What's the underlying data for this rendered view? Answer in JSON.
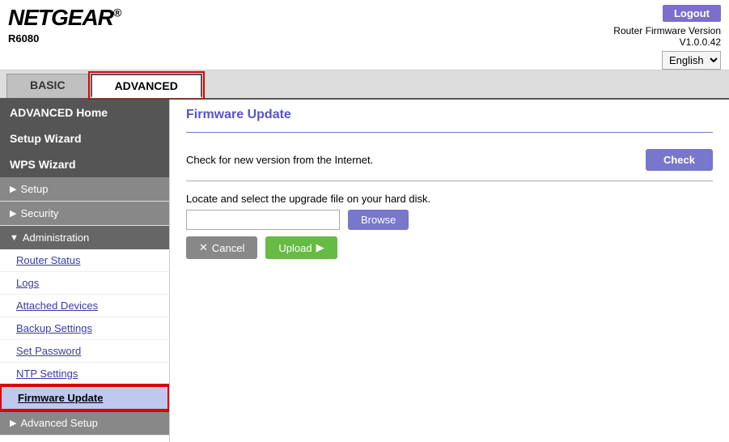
{
  "header": {
    "logo": "NETGEAR",
    "logo_reg": "®",
    "model": "R6080",
    "logout_label": "Logout",
    "firmware_version_label": "Router Firmware Version",
    "firmware_version": "V1.0.0.42",
    "language": "English"
  },
  "tabs": [
    {
      "id": "basic",
      "label": "BASIC",
      "active": false
    },
    {
      "id": "advanced",
      "label": "ADVANCED",
      "active": true
    }
  ],
  "sidebar": {
    "advanced_home": "ADVANCED Home",
    "setup_wizard": "Setup Wizard",
    "wps_wizard": "WPS Wizard",
    "setup": "Setup",
    "security": "Security",
    "administration": "Administration",
    "admin_items": [
      {
        "id": "router-status",
        "label": "Router Status"
      },
      {
        "id": "logs",
        "label": "Logs"
      },
      {
        "id": "attached-devices",
        "label": "Attached Devices"
      },
      {
        "id": "backup-settings",
        "label": "Backup Settings"
      },
      {
        "id": "set-password",
        "label": "Set Password"
      },
      {
        "id": "ntp-settings",
        "label": "NTP Settings"
      },
      {
        "id": "firmware-update",
        "label": "Firmware Update",
        "active": true
      }
    ],
    "advanced_setup": "Advanced Setup"
  },
  "content": {
    "page_title": "Firmware Update",
    "check_label": "Check for new version from the Internet.",
    "check_button": "Check",
    "upgrade_label": "Locate and select the upgrade file on your hard disk.",
    "browse_button": "Browse",
    "cancel_button": "Cancel",
    "upload_button": "Upload",
    "cancel_icon": "✕",
    "upload_icon": "▶"
  }
}
